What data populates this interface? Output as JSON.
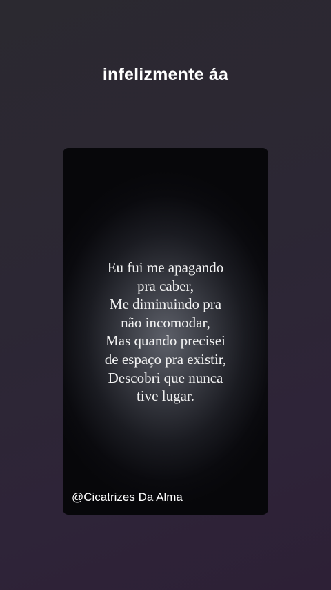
{
  "story": {
    "caption": "infelizmente áa"
  },
  "post": {
    "poem_lines": [
      "Eu fui me apagando",
      "pra caber,",
      "Me diminuindo pra",
      "não incomodar,",
      "Mas quando precisei",
      "de espaço pra existir,",
      "Descobri que nunca",
      "tive lugar."
    ],
    "author": "@Cicatrizes Da Alma"
  },
  "colors": {
    "background": "#2c2734",
    "card": "#07070a",
    "text": "#ffffff"
  }
}
